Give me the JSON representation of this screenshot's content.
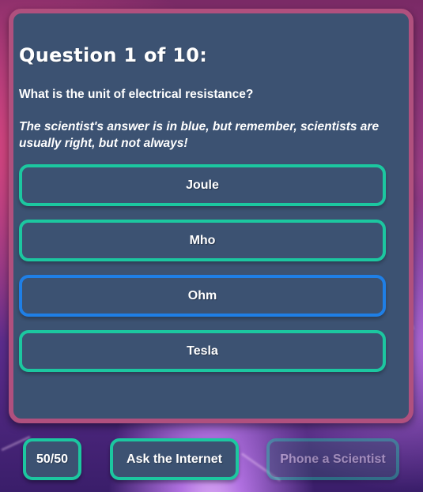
{
  "question": {
    "title": "Question 1 of 10:",
    "text": "What is the unit of electrical resistance?",
    "hint": "The scientist's answer is in blue, but remember, scientists are usually right, but not always!"
  },
  "answers": [
    {
      "label": "Joule",
      "highlight": false
    },
    {
      "label": "Mho",
      "highlight": false
    },
    {
      "label": "Ohm",
      "highlight": true
    },
    {
      "label": "Tesla",
      "highlight": false
    }
  ],
  "lifelines": {
    "fifty_fifty": "50/50",
    "ask_internet": "Ask the Internet",
    "phone_scientist": "Phone a Scientist",
    "phone_scientist_used": true
  },
  "colors": {
    "card_background": "#3c5272",
    "card_border": "#b0507e",
    "answer_border": "#1cc7a0",
    "scientist_border": "#1f7fe6"
  }
}
